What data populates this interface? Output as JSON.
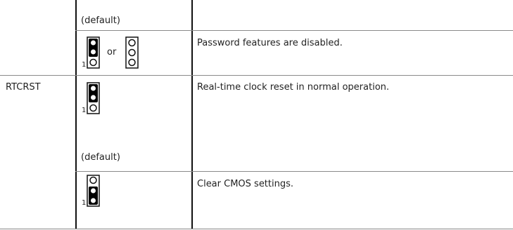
{
  "table": {
    "rows": [
      {
        "label": "",
        "setting_note": "(default)",
        "description": ""
      },
      {
        "label": "",
        "setting_icons": [
          "jumper-pins-1-2-installed-icon",
          "jumper-open-icon"
        ],
        "or_text": "or",
        "pin_number": "1",
        "description": "Password features are disabled."
      },
      {
        "label": "RTCRST",
        "setting_icons": [
          "jumper-pins-1-2-installed-icon"
        ],
        "pin_number": "1",
        "setting_note": "(default)",
        "description": "Real-time clock reset in normal operation."
      },
      {
        "label": "",
        "setting_icons": [
          "jumper-pins-1-2-installed-icon-rtc"
        ],
        "pin_number": "1",
        "description": "Clear CMOS settings."
      }
    ]
  },
  "colors": {
    "text": "#222222",
    "rule": "#8a8a8a",
    "column_rule": "#111111",
    "jumper_fill": "#000000"
  }
}
